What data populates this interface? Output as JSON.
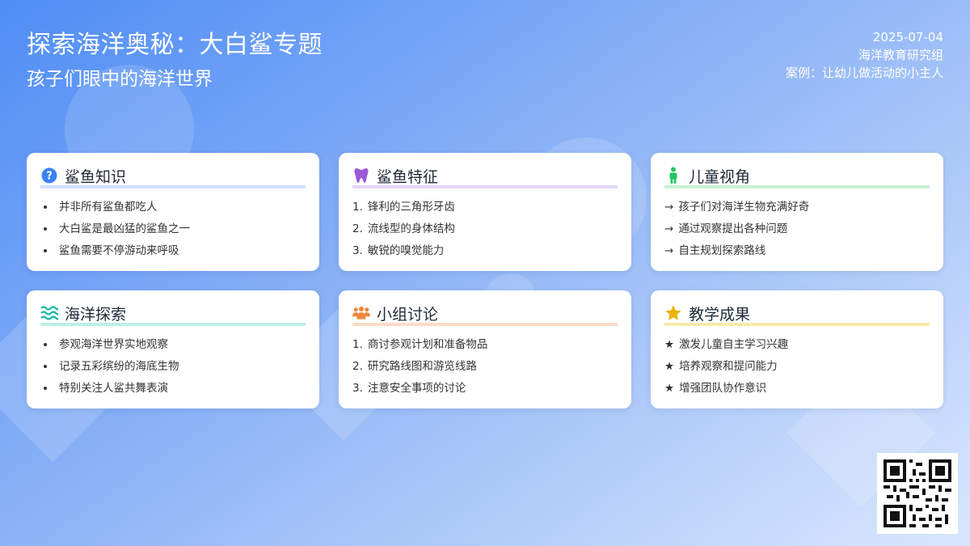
{
  "header": {
    "title": "探索海洋奥秘：大白鲨专题",
    "subtitle": "孩子们眼中的海洋世界"
  },
  "meta": {
    "date": "2025-07-04",
    "org": "海洋教育研究组",
    "case": "案例：让幼儿做活动的小主人"
  },
  "colors": {
    "background_start": "#4f8df5",
    "background_end": "#d9e7fd",
    "card_bg": "#ffffff"
  },
  "cards": [
    {
      "title": "鲨鱼知识",
      "icon": "question-icon",
      "accent": "#3b82f6",
      "underline": "#cfe0fb",
      "style": "dot",
      "items": [
        "并非所有鲨鱼都吃人",
        "大白鲨是最凶猛的鲨鱼之一",
        "鲨鱼需要不停游动来呼吸"
      ]
    },
    {
      "title": "鲨鱼特征",
      "icon": "tooth-icon",
      "accent": "#9b59d6",
      "underline": "#e6d6fa",
      "style": "number",
      "items": [
        "锋利的三角形牙齿",
        "流线型的身体结构",
        "敏锐的嗅觉能力"
      ]
    },
    {
      "title": "儿童视角",
      "icon": "child-icon",
      "accent": "#22c55e",
      "underline": "#c7f0d6",
      "style": "arrow",
      "items": [
        "孩子们对海洋生物充满好奇",
        "通过观察提出各种问题",
        "自主规划探索路线"
      ]
    },
    {
      "title": "海洋探索",
      "icon": "waves-icon",
      "accent": "#14b8a6",
      "underline": "#bdeee6",
      "style": "dot",
      "items": [
        "参观海洋世界实地观察",
        "记录五彩缤纷的海底生物",
        "特别关注人鲨共舞表演"
      ]
    },
    {
      "title": "小组讨论",
      "icon": "group-icon",
      "accent": "#f0883e",
      "underline": "#fbdcc6",
      "style": "number",
      "items": [
        "商讨参观计划和准备物品",
        "研究路线图和游览线路",
        "注意安全事项的讨论"
      ]
    },
    {
      "title": "教学成果",
      "icon": "star-icon",
      "accent": "#eab308",
      "underline": "#f8eaa8",
      "style": "star",
      "items": [
        "激发儿童自主学习兴趣",
        "培养观察和提问能力",
        "增强团队协作意识"
      ]
    }
  ],
  "qr": {
    "icon": "qr-code-icon"
  }
}
